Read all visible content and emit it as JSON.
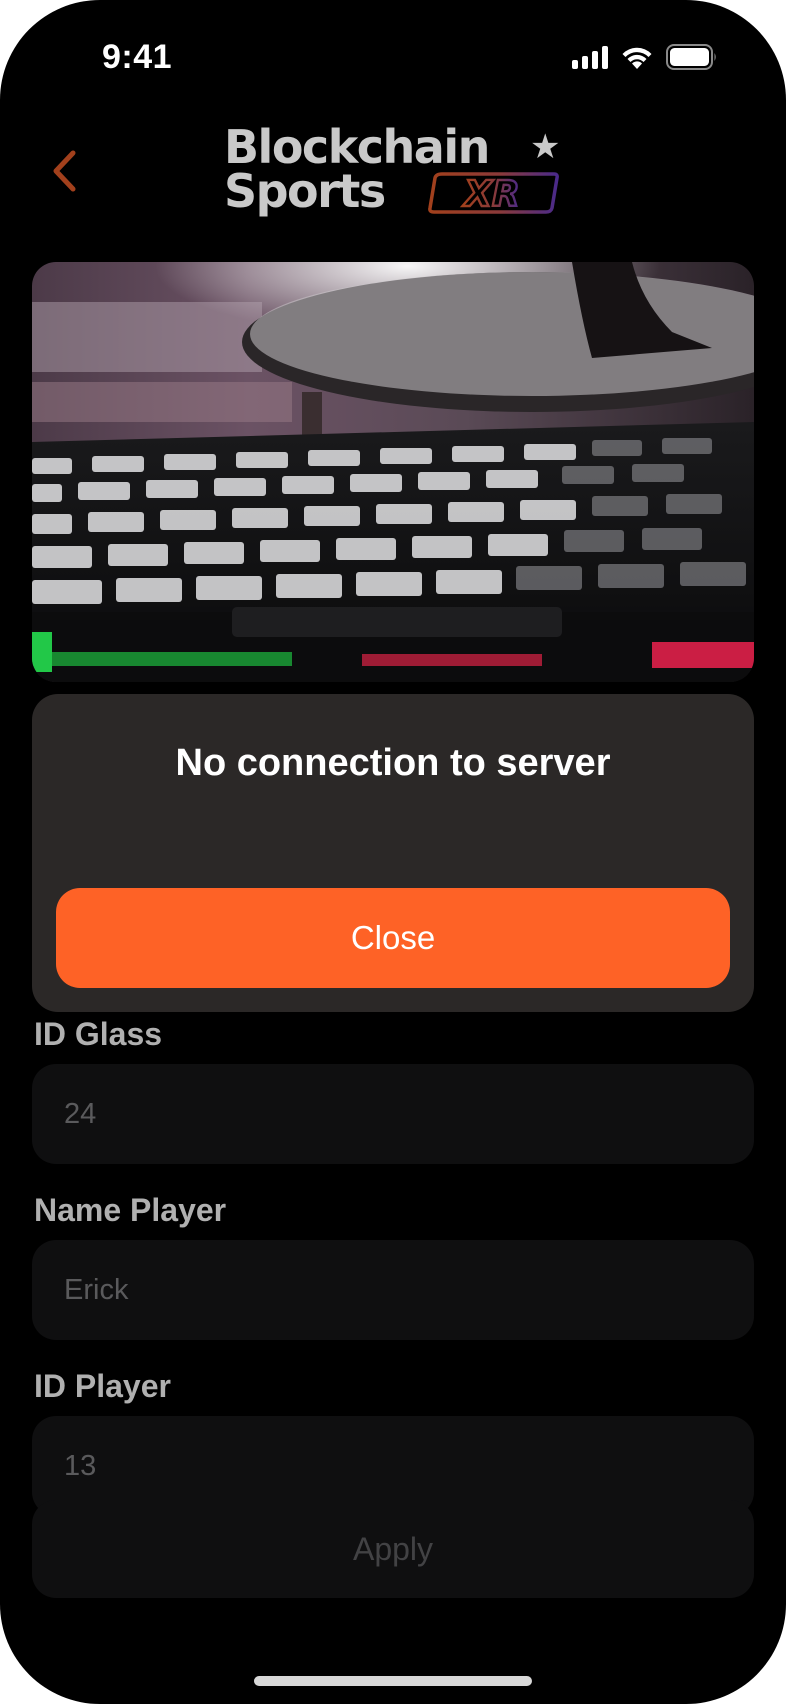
{
  "status_bar": {
    "time": "9:41"
  },
  "header": {
    "brand_line1": "Blockchain",
    "brand_line2": "Sports",
    "brand_badge": "XR"
  },
  "hero": {
    "image": "keyboard-photo"
  },
  "dialog": {
    "title": "No connection to server",
    "close_label": "Close"
  },
  "form": {
    "id_glass": {
      "label": "ID Glass",
      "value": "24"
    },
    "name_player": {
      "label": "Name Player",
      "value": "Erick"
    },
    "id_player": {
      "label": "ID Player",
      "value": "13"
    },
    "apply_label": "Apply"
  },
  "colors": {
    "accent": "#fe6226",
    "dialog_bg": "#2b2827",
    "field_bg": "#0f0f10",
    "back_arrow": "#a2401c"
  }
}
